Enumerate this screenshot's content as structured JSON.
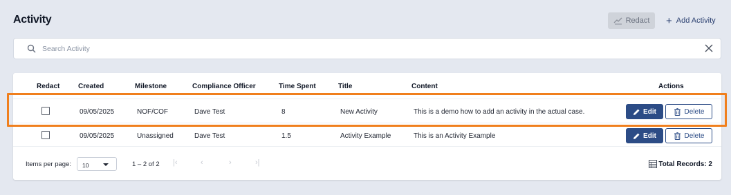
{
  "header": {
    "title": "Activity",
    "redact_label": "Redact",
    "add_label": "Add Activity"
  },
  "search": {
    "placeholder": "Search Activity",
    "value": ""
  },
  "table": {
    "columns": [
      "Redact",
      "Created",
      "Milestone",
      "Compliance Officer",
      "Time Spent",
      "Title",
      "Content",
      "Actions"
    ],
    "rows": [
      {
        "created": "09/05/2025",
        "milestone": "NOF/COF",
        "officer": "Dave Test",
        "time_spent": "8",
        "title": "New Activity",
        "content": "This is a demo how to add an activity in the actual case.",
        "redacted": false
      },
      {
        "created": "09/05/2025",
        "milestone": "Unassigned",
        "officer": "Dave Test",
        "time_spent": "1.5",
        "title": "Activity Example",
        "content": "This is an Activity Example",
        "redacted": false
      }
    ],
    "edit_label": "Edit",
    "delete_label": "Delete"
  },
  "pagination": {
    "items_per_page_label": "Items per page:",
    "page_size": "10",
    "range_label": "1 – 2 of 2",
    "total_records_label": "Total Records: 2"
  },
  "colors": {
    "primary": "#2c4c86",
    "highlight": "#f07f1d",
    "background": "#e4e8f0"
  },
  "icons": {
    "search": "search-icon",
    "clear": "close-icon",
    "redact": "redact-icon",
    "add": "plus-icon",
    "edit": "pencil-icon",
    "delete": "trash-icon",
    "total": "table-list-icon"
  }
}
